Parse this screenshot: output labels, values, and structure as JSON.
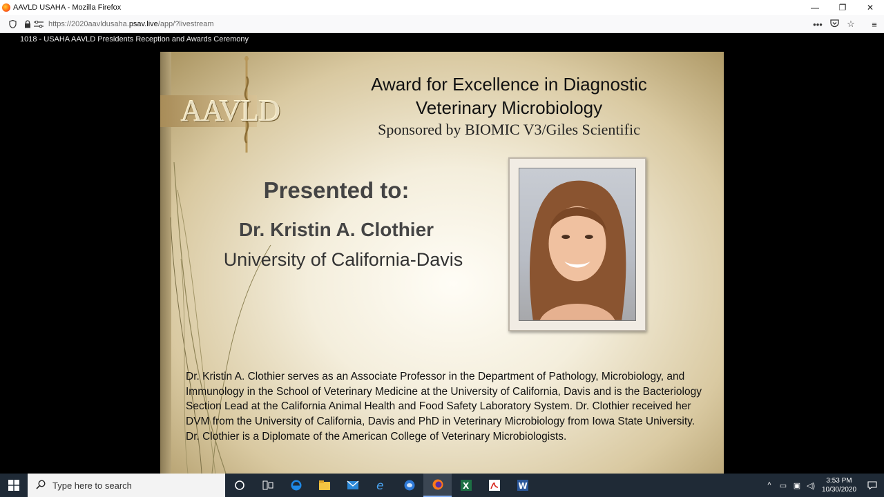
{
  "window": {
    "title": "AAVLD USAHA - Mozilla Firefox",
    "minimize": "—",
    "restore": "❐",
    "close": "✕"
  },
  "navbar": {
    "url_prefix": "https://2020aavldusaha.",
    "url_host": "psav.live",
    "url_path": "/app/?livestream",
    "more_icon": "•••",
    "pocket_icon": "▿",
    "star_icon": "☆",
    "menu_icon": "≡"
  },
  "stream": {
    "title": "1018 - USAHA AAVLD Presidents Reception and Awards Ceremony"
  },
  "slide": {
    "logo_text": "AAVLD",
    "award_line1": "Award for Excellence in Diagnostic",
    "award_line2": "Veterinary Microbiology",
    "sponsor": "Sponsored by BIOMIC V3/Giles Scientific",
    "presented_to": "Presented to:",
    "recipient_name": "Dr. Kristin A. Clothier",
    "recipient_affiliation": "University of California-Davis",
    "bio": "Dr. Kristin A. Clothier serves as an Associate Professor in the Department of Pathology, Microbiology, and Immunology in the School of Veterinary Medicine at the University of California, Davis and is the Bacteriology Section Lead at the California Animal Health and Food Safety Laboratory System.  Dr. Clothier received her DVM from the University of California, Davis and PhD in Veterinary Microbiology from Iowa State University.  Dr. Clothier is a Diplomate of the American College of Veterinary Microbiologists."
  },
  "taskbar": {
    "search_placeholder": "Type here to search",
    "time": "3:53 PM",
    "date": "10/30/2020",
    "apps": [
      "cortana-icon",
      "task-view-icon",
      "edge-icon",
      "file-explorer-icon",
      "mail-icon",
      "internet-explorer-icon",
      "outlook-icon",
      "firefox-icon",
      "excel-icon",
      "acrobat-icon",
      "word-icon"
    ]
  }
}
